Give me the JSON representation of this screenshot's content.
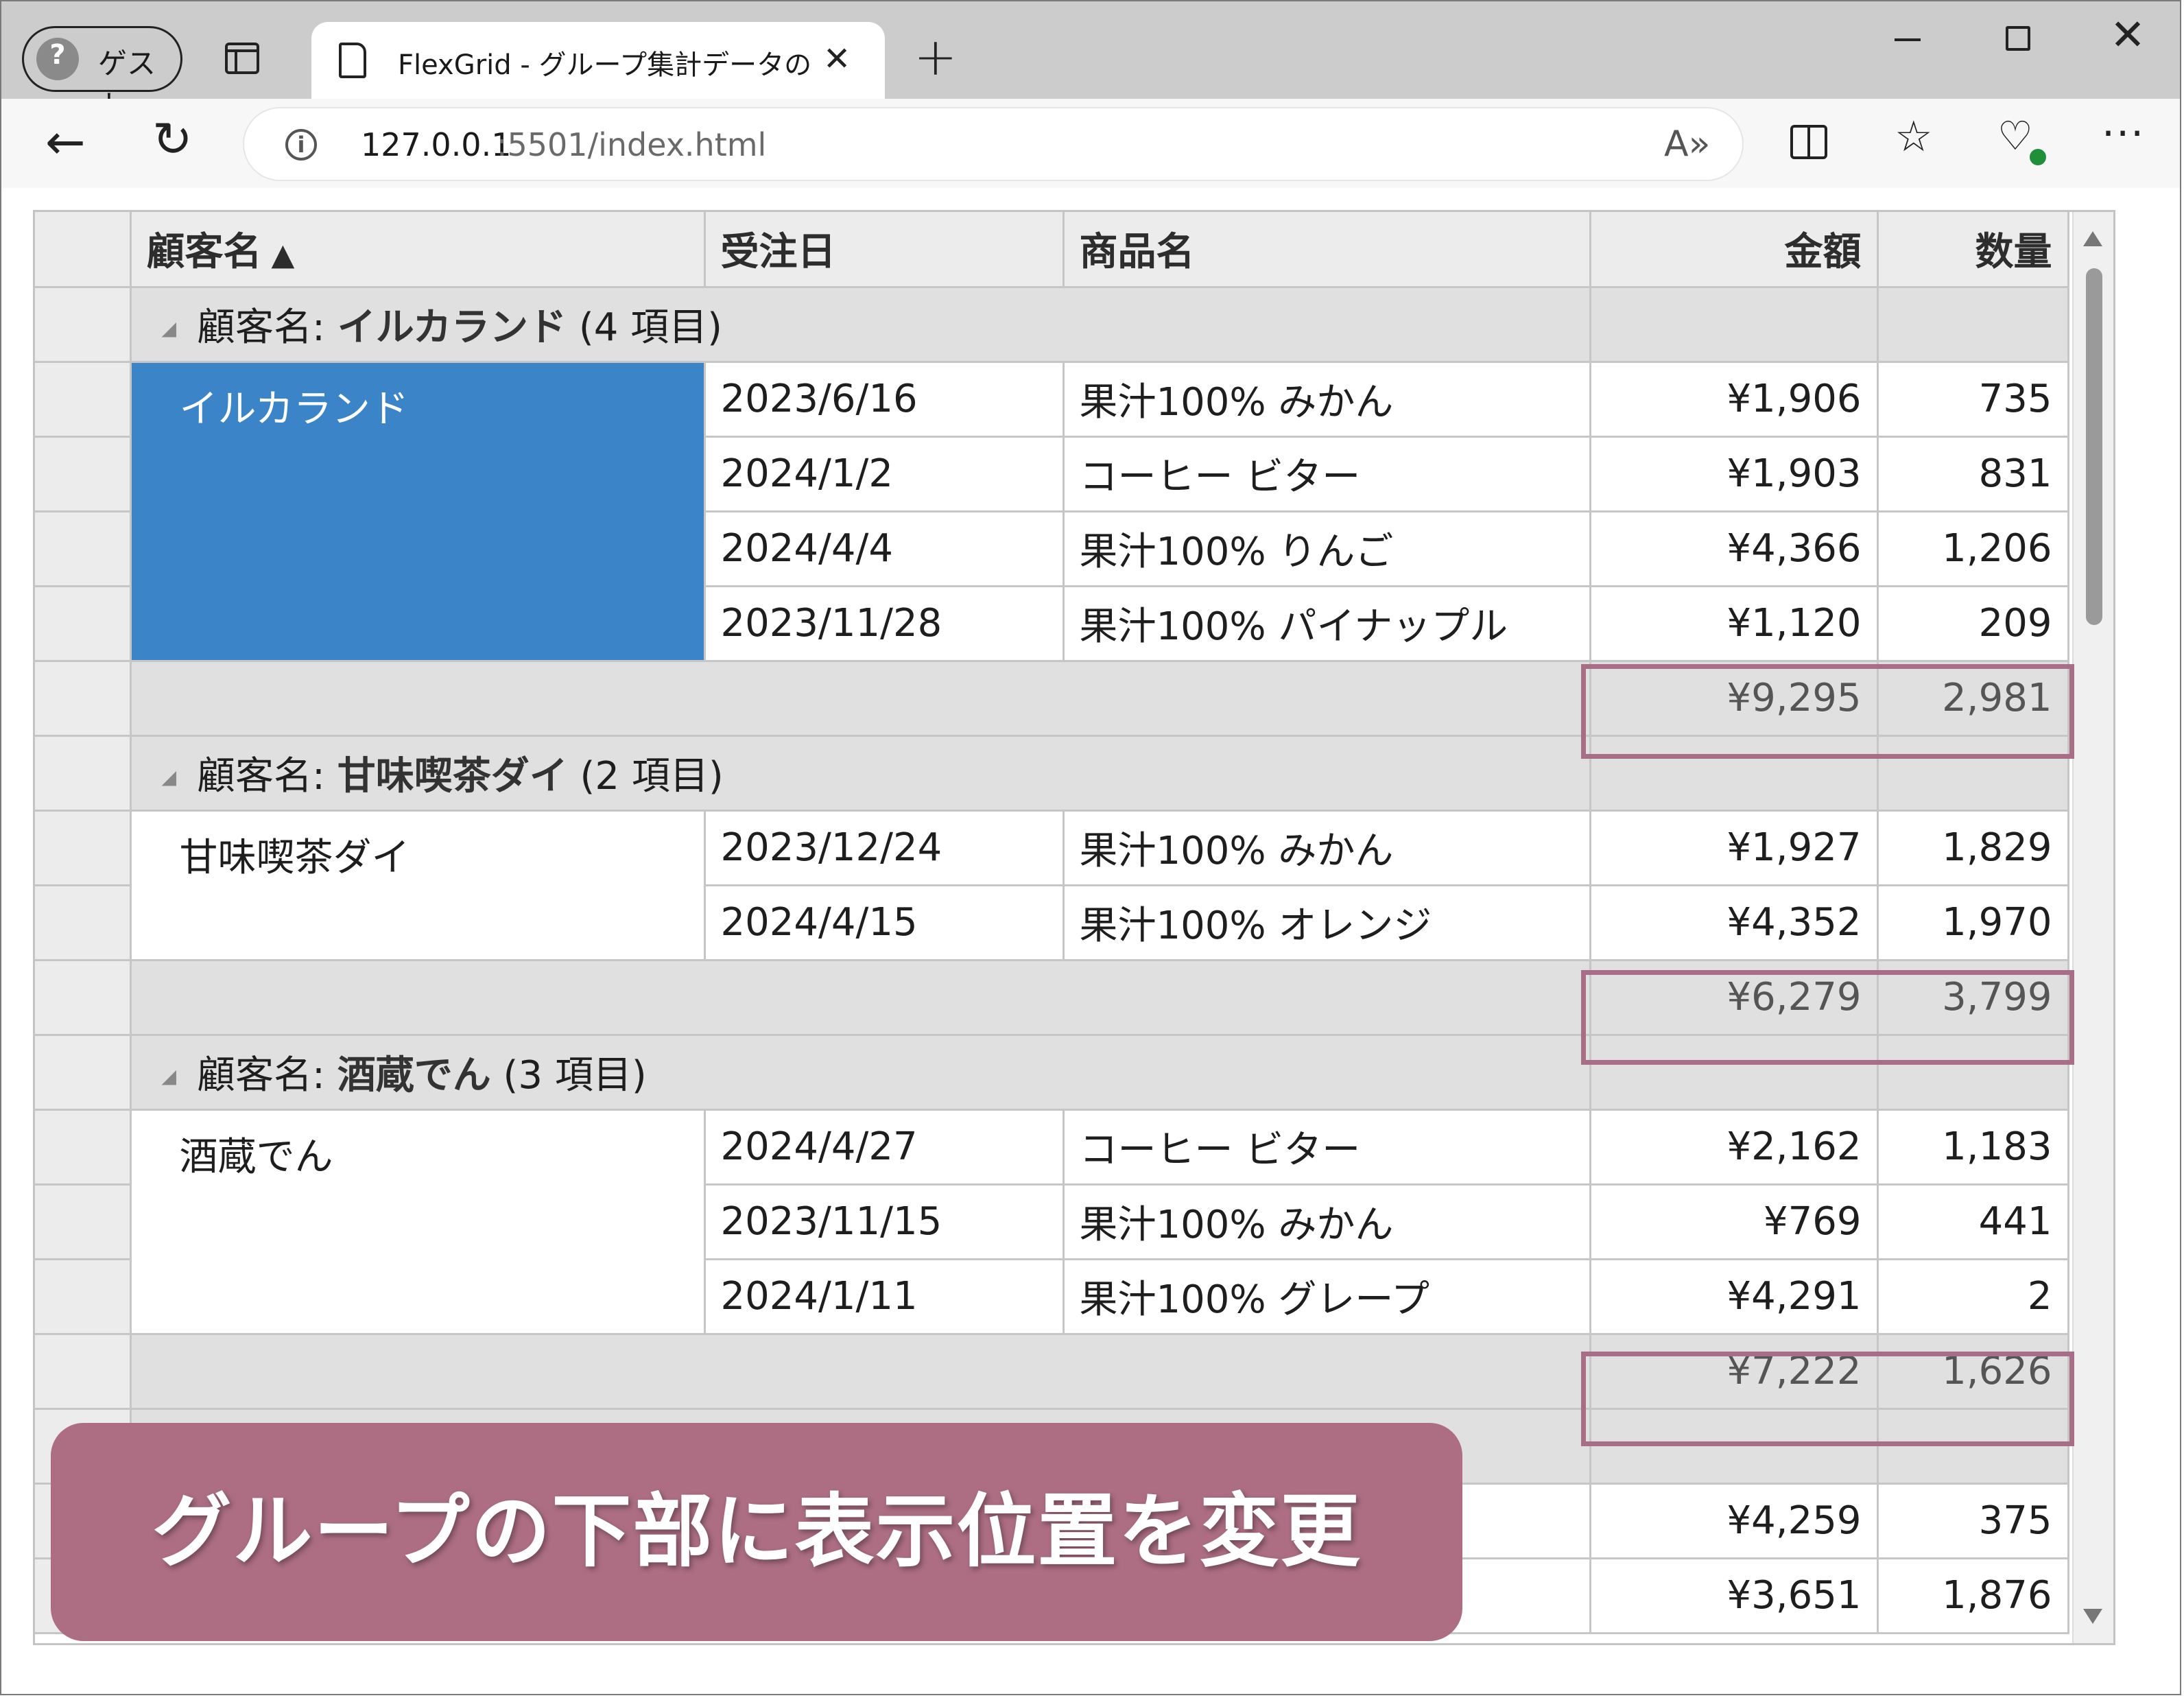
{
  "browser": {
    "profile_label": "ゲスト",
    "tab_title": "FlexGrid - グループ集計データの表示",
    "url_host": "127.0.0.1",
    "url_path": ":5501/index.html"
  },
  "grid": {
    "columns": [
      "顧客名",
      "受注日",
      "商品名",
      "金額",
      "数量"
    ],
    "sort": {
      "column": "顧客名",
      "direction": "ascending"
    },
    "groups": [
      {
        "prefix": "顧客名:",
        "name": "イルカランド",
        "count": "(4 項目)",
        "customer": "イルカランド",
        "rows": [
          {
            "date": "2023/6/16",
            "product": "果汁100% みかん",
            "amount": "¥1,906",
            "qty": "735"
          },
          {
            "date": "2024/1/2",
            "product": "コーヒー ビター",
            "amount": "¥1,903",
            "qty": "831"
          },
          {
            "date": "2024/4/4",
            "product": "果汁100% りんご",
            "amount": "¥4,366",
            "qty": "1,206"
          },
          {
            "date": "2023/11/28",
            "product": "果汁100% パイナップル",
            "amount": "¥1,120",
            "qty": "209"
          }
        ],
        "total_amount": "¥9,295",
        "total_qty": "2,981"
      },
      {
        "prefix": "顧客名:",
        "name": "甘味喫茶ダイ",
        "count": "(2 項目)",
        "customer": "甘味喫茶ダイ",
        "rows": [
          {
            "date": "2023/12/24",
            "product": "果汁100% みかん",
            "amount": "¥1,927",
            "qty": "1,829"
          },
          {
            "date": "2024/4/15",
            "product": "果汁100% オレンジ",
            "amount": "¥4,352",
            "qty": "1,970"
          }
        ],
        "total_amount": "¥6,279",
        "total_qty": "3,799"
      },
      {
        "prefix": "顧客名:",
        "name": "酒蔵でん",
        "count": "(3 項目)",
        "customer": "酒蔵でん",
        "rows": [
          {
            "date": "2024/4/27",
            "product": "コーヒー ビター",
            "amount": "¥2,162",
            "qty": "1,183"
          },
          {
            "date": "2023/11/15",
            "product": "果汁100% みかん",
            "amount": "¥769",
            "qty": "441"
          },
          {
            "date": "2024/1/11",
            "product": "果汁100% グレープ",
            "amount": "¥4,291",
            "qty": "2"
          }
        ],
        "total_amount": "¥7,222",
        "total_qty": "1,626"
      }
    ],
    "partial_rows": [
      {
        "amount": "¥4,259",
        "qty": "375"
      },
      {
        "amount": "¥3,651",
        "qty": "1,876"
      }
    ]
  },
  "caption": "グループの下部に表示位置を変更",
  "colors": {
    "selection": "#3b84c8",
    "highlight_border": "#a86e88",
    "caption_bg": "#ad6e84"
  }
}
